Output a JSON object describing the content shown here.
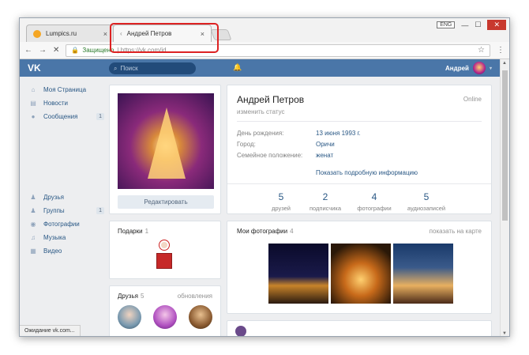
{
  "browser": {
    "tabs": [
      {
        "title": "Lumpics.ru"
      },
      {
        "title": "Андрей Петров"
      }
    ],
    "lang_badge": "ENG",
    "window_controls": {
      "minimize": "—",
      "maximize": "☐",
      "close": "✕"
    },
    "address": {
      "secure_label": "Защищено",
      "url_rest": "| https://vk.com/id..."
    },
    "status_text": "Ожидание vk.com..."
  },
  "vk": {
    "logo": "VK",
    "search_placeholder": "Поиск",
    "user_name": "Андрей",
    "nav": [
      {
        "label": "Моя Страница",
        "icon": "home-icon",
        "count": ""
      },
      {
        "label": "Новости",
        "icon": "news-icon",
        "count": ""
      },
      {
        "label": "Сообщения",
        "icon": "message-icon",
        "count": "1"
      },
      {
        "label": "Друзья",
        "icon": "friend-icon",
        "count": ""
      },
      {
        "label": "Группы",
        "icon": "group-icon",
        "count": "1"
      },
      {
        "label": "Фотографии",
        "icon": "camera-icon",
        "count": ""
      },
      {
        "label": "Музыка",
        "icon": "music-icon",
        "count": ""
      },
      {
        "label": "Видео",
        "icon": "video-icon",
        "count": ""
      }
    ],
    "edit_button": "Редактировать",
    "gifts": {
      "title": "Подарки",
      "count": "1"
    },
    "friends": {
      "title": "Друзья",
      "count": "5",
      "updates": "обновления"
    },
    "profile": {
      "name": "Андрей Петров",
      "status": "изменить статус",
      "online": "Online",
      "fields": [
        {
          "label": "День рождения:",
          "value": "13 июня 1993 г."
        },
        {
          "label": "Город:",
          "value": "Оричи"
        },
        {
          "label": "Семейное положение:",
          "value": "женат"
        }
      ],
      "more": "Показать подробную информацию",
      "stats": [
        {
          "num": "5",
          "label": "друзей"
        },
        {
          "num": "2",
          "label": "подписчика"
        },
        {
          "num": "4",
          "label": "фотографии"
        },
        {
          "num": "5",
          "label": "аудиозаписей"
        }
      ]
    },
    "photos": {
      "title": "Мои фотографии",
      "count": "4",
      "map_link": "показать на карте"
    }
  },
  "colors": {
    "vk_blue": "#4a76a8",
    "link": "#2a5885",
    "highlight": "#dd2222"
  }
}
